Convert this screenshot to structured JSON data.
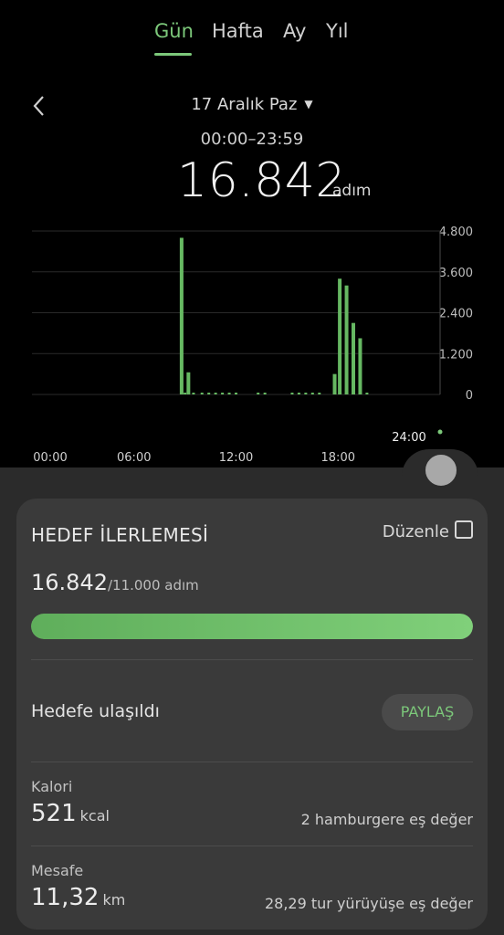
{
  "tabs": [
    {
      "label": "Gün",
      "active": true
    },
    {
      "label": "Hafta",
      "active": false
    },
    {
      "label": "Ay",
      "active": false
    },
    {
      "label": "Yıl",
      "active": false
    }
  ],
  "date": {
    "label": "17 Aralık Paz"
  },
  "time_range": "00:00–23:59",
  "total": {
    "value": "16.842",
    "unit": "adım"
  },
  "colors": {
    "accent": "#7cc87a",
    "bar": "#66b862",
    "background": "#000000",
    "panel": "#2b2b2b",
    "card": "#3a3a3a"
  },
  "chart_data": {
    "type": "bar",
    "ylim": [
      0,
      4800
    ],
    "y_ticks": [
      "4.800",
      "3.600",
      "2.400",
      "1.200",
      "0"
    ],
    "x_ticks": [
      "00:00",
      "06:00",
      "12:00",
      "18:00"
    ],
    "current_time_label": "24:00",
    "x_unit": "hour",
    "x": [
      8.8,
      9.2,
      17.8,
      18.1,
      18.5,
      18.9,
      19.3
    ],
    "values": [
      4600,
      650,
      600,
      3400,
      3200,
      2100,
      1650
    ],
    "small_x": [
      9.0,
      9.5,
      10.0,
      10.4,
      10.8,
      11.2,
      11.6,
      12.0,
      13.3,
      13.7,
      15.3,
      15.7,
      16.1,
      16.5,
      16.9,
      19.7
    ]
  },
  "goal": {
    "title": "HEDEF İLERLEMESİ",
    "edit_label": "Düzenle",
    "current": "16.842",
    "target_text": "/11.000 adım",
    "progress_fraction": 1.0,
    "status": "Hedefe ulaşıldı",
    "share_label": "PAYLAŞ"
  },
  "calories": {
    "label": "Kalori",
    "value": "521",
    "unit": "kcal",
    "equivalent": "2 hamburgere eş değer"
  },
  "distance": {
    "label": "Mesafe",
    "value": "11,32",
    "unit": "km",
    "equivalent": "28,29 tur yürüyüşe eş değer"
  }
}
